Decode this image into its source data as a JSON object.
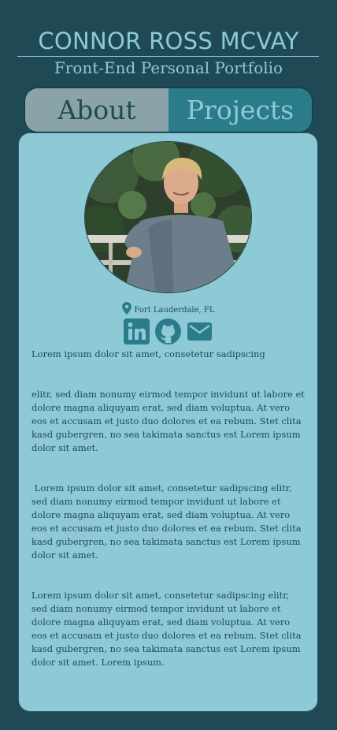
{
  "header": {
    "name": "CONNOR ROSS MCVAY",
    "subtitle": "Front-End Personal Portfolio"
  },
  "tabs": [
    {
      "label": "About",
      "active": true
    },
    {
      "label": "Projects",
      "active": false
    }
  ],
  "profile": {
    "location": "Fort Lauderdale, FL",
    "social": [
      "linkedin-icon",
      "github-icon",
      "mail-icon"
    ]
  },
  "bio": {
    "p1": "Lorem ipsum dolor sit amet, consetetur sadipscing",
    "p2": "elitr, sed diam nonumy eirmod tempor invidunt ut labore et dolore magna aliquyam erat, sed diam voluptua. At vero eos et accusam et justo duo dolores et ea rebum. Stet clita kasd gubergren, no sea takimata sanctus est Lorem ipsum dolor sit amet.",
    "p3": " Lorem ipsum dolor sit amet, consetetur sadipscing elitr, sed diam nonumy eirmod tempor invidunt ut labore et dolore magna aliquyam erat, sed diam voluptua. At vero eos et accusam et justo duo dolores et ea rebum. Stet clita kasd gubergren, no sea takimata sanctus est Lorem ipsum dolor sit amet.",
    "p4": "Lorem ipsum dolor sit amet, consetetur sadipscing elitr, sed diam nonumy eirmod tempor invidunt ut labore et dolore magna aliquyam erat, sed diam voluptua. At vero eos et accusam et justo duo dolores et ea rebum. Stet clita kasd gubergren, no sea takimata sanctus est Lorem ipsum dolor sit amet. Lorem ipsum."
  },
  "colors": {
    "background": "#1f4a55",
    "accent": "#8ec9d6",
    "tab_active": "#8aa3a8",
    "tab_inactive": "#2b7c8a",
    "icon": "#2b7c8a"
  }
}
